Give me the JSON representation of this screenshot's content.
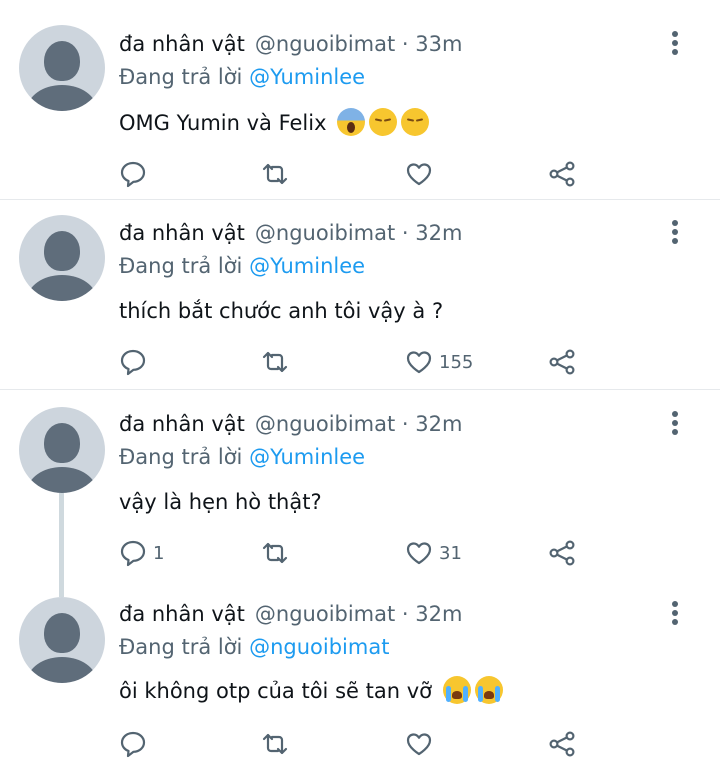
{
  "tweets": [
    {
      "name": "đa nhân vật",
      "handle": "@nguoibimat",
      "time": "33m",
      "reply_prefix": "Đang trả lời",
      "reply_to": "@Yuminlee",
      "text": "OMG Yumin và Felix",
      "emojis": [
        "face-screaming-in-fear",
        "pensive-face",
        "pensive-face"
      ],
      "reply_count": "",
      "like_count": ""
    },
    {
      "name": "đa nhân vật",
      "handle": "@nguoibimat",
      "time": "32m",
      "reply_prefix": "Đang trả lời",
      "reply_to": "@Yuminlee",
      "text": "thích bắt chước anh tôi vậy à ?",
      "emojis": [],
      "reply_count": "",
      "like_count": "155"
    },
    {
      "name": "đa nhân vật",
      "handle": "@nguoibimat",
      "time": "32m",
      "reply_prefix": "Đang trả lời",
      "reply_to": "@Yuminlee",
      "text": "vậy là hẹn hò thật?",
      "emojis": [],
      "reply_count": "1",
      "like_count": "31"
    },
    {
      "name": "đa nhân vật",
      "handle": "@nguoibimat",
      "time": "32m",
      "reply_prefix": "Đang trả lời",
      "reply_to": "@nguoibimat",
      "text": "ôi không otp của tôi sẽ tan vỡ",
      "emojis": [
        "loudly-crying-face",
        "loudly-crying-face"
      ],
      "reply_count": "",
      "like_count": ""
    }
  ],
  "meta_separator": " · ",
  "icons": {
    "reply": "reply-bubble-icon",
    "retweet": "retweet-icon",
    "like": "heart-icon",
    "share": "share-icon",
    "more": "more-vertical-icon"
  },
  "colors": {
    "mention": "#1d9bf0",
    "secondary_text": "#536471",
    "avatar_bg": "#cdd5dd",
    "avatar_fg": "#5f6d7b"
  }
}
